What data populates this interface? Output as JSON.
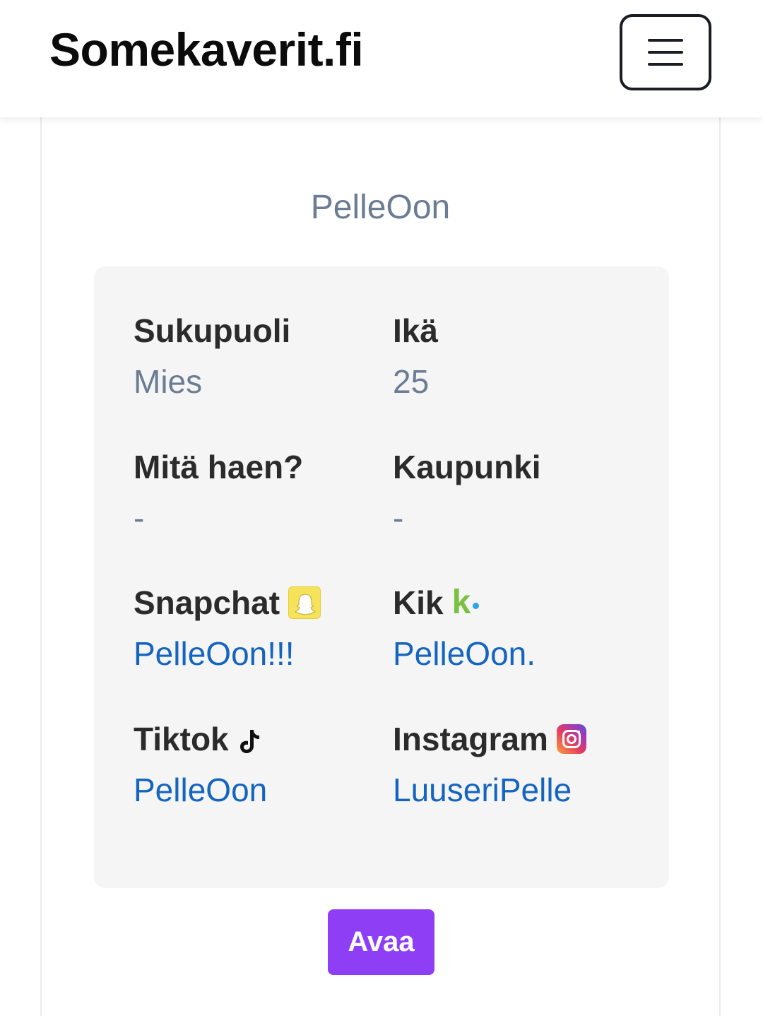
{
  "header": {
    "brand": "Somekaverit.fi",
    "menu_icon": "hamburger-menu-icon"
  },
  "profile": {
    "username": "PelleOon",
    "fields": {
      "gender": {
        "label": "Sukupuoli",
        "value": "Mies"
      },
      "age": {
        "label": "Ikä",
        "value": "25"
      },
      "looking_for": {
        "label": "Mitä haen?",
        "value": "-"
      },
      "city": {
        "label": "Kaupunki",
        "value": "-"
      },
      "snapchat": {
        "label": "Snapchat",
        "value": "PelleOon!!!",
        "icon": "snapchat-icon"
      },
      "kik": {
        "label": "Kik",
        "value": "PelleOon.",
        "icon": "kik-icon",
        "icon_text": "k"
      },
      "tiktok": {
        "label": "Tiktok",
        "value": "PelleOon",
        "icon": "tiktok-icon"
      },
      "instagram": {
        "label": "Instagram",
        "value": "LuuseriPelle",
        "icon": "instagram-icon"
      }
    },
    "open_button": "Avaa"
  },
  "colors": {
    "accent": "#8e3ff5",
    "link": "#1565c0",
    "muted_text": "#6b7c93",
    "card_bg": "#f5f5f5"
  }
}
